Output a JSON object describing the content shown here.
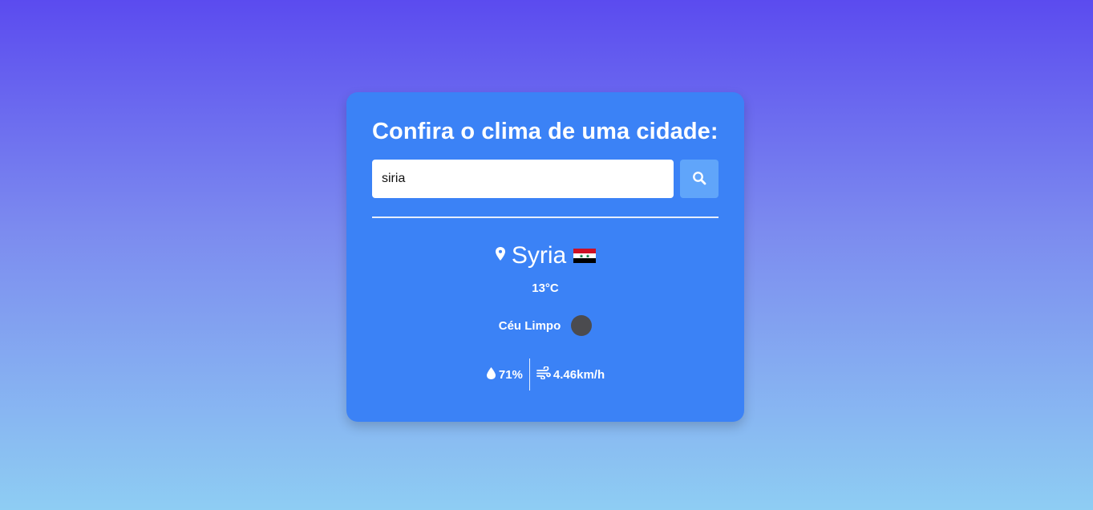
{
  "card": {
    "title": "Confira o clima de uma cidade:",
    "search": {
      "value": "siria",
      "placeholder": "",
      "button_icon": "search-icon"
    },
    "city": {
      "icon": "location-pin-icon",
      "name": "Syria",
      "flag": "syria-flag-icon"
    },
    "temperature": "13°C",
    "description": "Céu Limpo",
    "weather_icon": "clear-sky-icon",
    "humidity": {
      "icon": "water-drop-icon",
      "value": "71%"
    },
    "wind": {
      "icon": "wind-icon",
      "value": "4.46km/h"
    }
  },
  "colors": {
    "background_top": "#5b4bef",
    "background_bottom": "#8ecdf3",
    "card": "#3b82f6",
    "search_button": "#60a5fa",
    "flag": [
      "#ce1126",
      "#ffffff",
      "#000000"
    ],
    "flag_stars": "#007a3d"
  }
}
